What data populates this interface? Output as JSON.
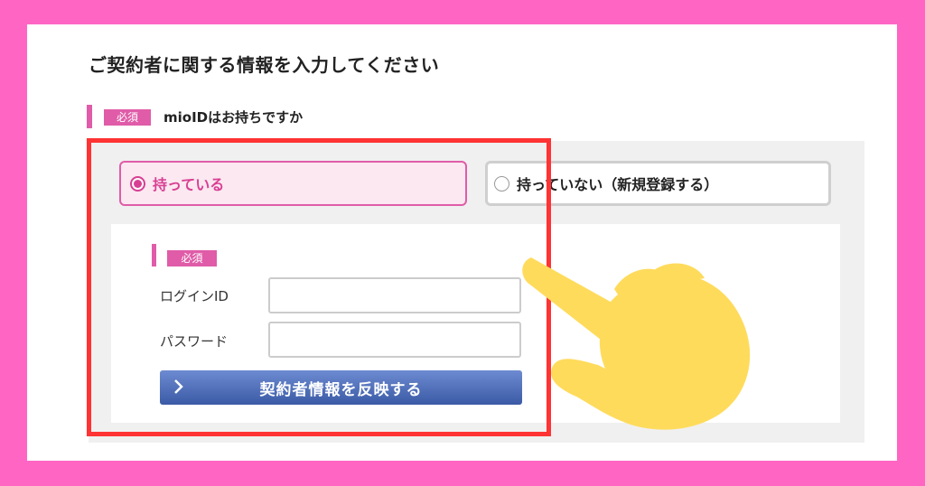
{
  "page": {
    "title": "ご契約者に関する情報を入力してください"
  },
  "question": {
    "required_badge": "必須",
    "label": "mioIDはお持ちですか"
  },
  "options": [
    {
      "label": "持っている",
      "selected": true
    },
    {
      "label": "持っていない（新規登録する）",
      "selected": false
    }
  ],
  "login_form": {
    "required_badge": "必須",
    "login_id_label": "ログインID",
    "login_id_value": "",
    "password_label": "パスワード",
    "password_value": "",
    "submit_label": "契約者情報を反映する"
  },
  "colors": {
    "border_pink": "#ff66c4",
    "accent_pink": "#e05ca8",
    "highlight_red": "#ff3333",
    "button_blue": "#3b5aa6",
    "hand_yellow": "#ffdb5c"
  },
  "icons": {
    "chevron": "chevron-right-icon",
    "hand": "pointing-hand-icon"
  }
}
